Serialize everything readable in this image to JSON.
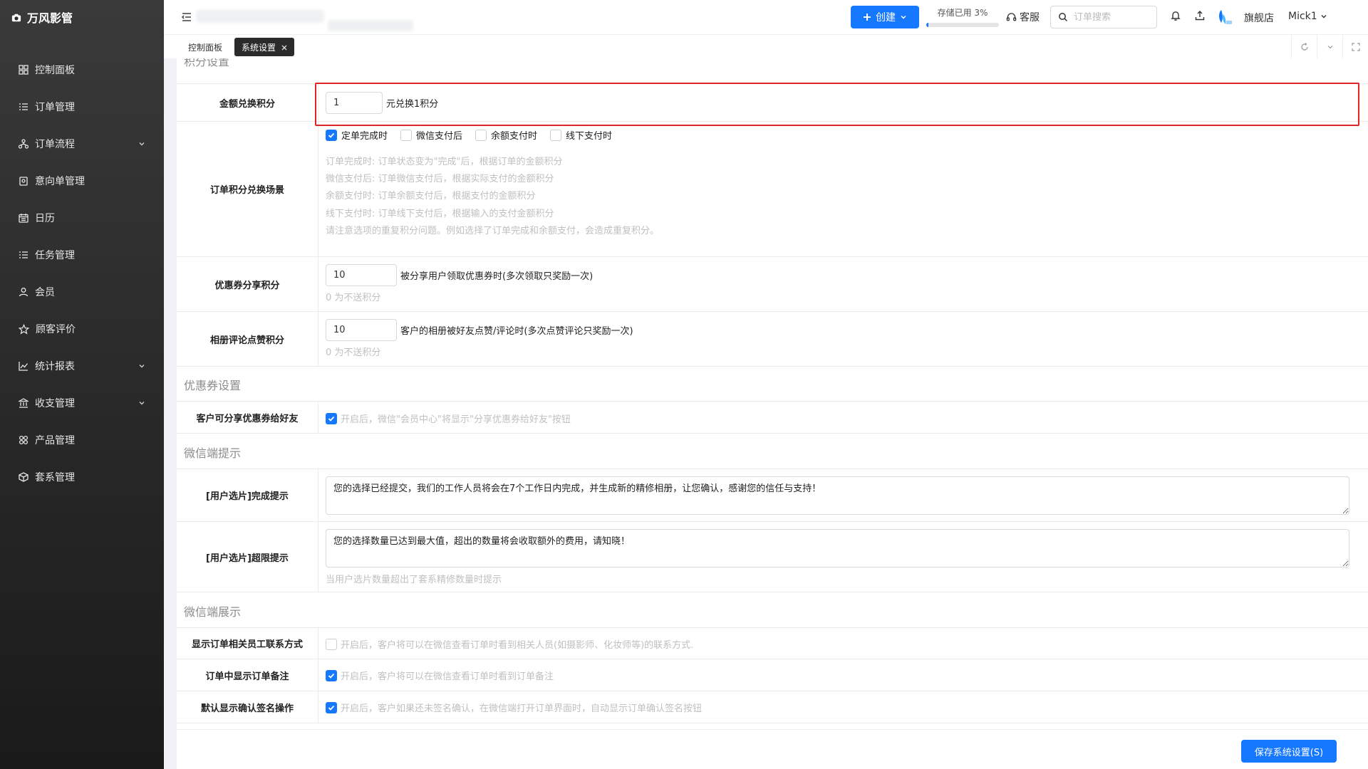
{
  "brand": {
    "name": "万风影管"
  },
  "sidebar": {
    "items": [
      {
        "label": "控制面板",
        "icon": "grid-icon",
        "expandable": false
      },
      {
        "label": "订单管理",
        "icon": "list-icon",
        "expandable": false
      },
      {
        "label": "订单流程",
        "icon": "flow-icon",
        "expandable": true
      },
      {
        "label": "意向单管理",
        "icon": "clipboard-icon",
        "expandable": false
      },
      {
        "label": "日历",
        "icon": "calendar-icon",
        "expandable": false
      },
      {
        "label": "任务管理",
        "icon": "tasks-icon",
        "expandable": false
      },
      {
        "label": "会员",
        "icon": "user-icon",
        "expandable": false
      },
      {
        "label": "顾客评价",
        "icon": "star-icon",
        "expandable": false
      },
      {
        "label": "统计报表",
        "icon": "chart-icon",
        "expandable": true
      },
      {
        "label": "收支管理",
        "icon": "bank-icon",
        "expandable": true
      },
      {
        "label": "产品管理",
        "icon": "products-icon",
        "expandable": false
      },
      {
        "label": "套系管理",
        "icon": "package-icon",
        "expandable": false
      }
    ]
  },
  "header": {
    "create_label": "创建",
    "storage_label": "存储已用 3%",
    "storage_percent": 3,
    "customer_service": "客服",
    "search_placeholder": "订单搜索",
    "shop_name": "旗舰店",
    "user_name": "Mick1"
  },
  "tabs": [
    {
      "label": "控制面板",
      "active": false
    },
    {
      "label": "系统设置",
      "active": true
    }
  ],
  "points": {
    "partial_title": "积分设置",
    "exchange": {
      "label": "金额兑换积分",
      "value": "1",
      "suffix": "元兑换1积分"
    },
    "scene": {
      "label": "订单积分兑换场景",
      "options": [
        {
          "label": "定单完成时",
          "checked": true
        },
        {
          "label": "微信支付后",
          "checked": false
        },
        {
          "label": "余额支付时",
          "checked": false
        },
        {
          "label": "线下支付时",
          "checked": false
        }
      ],
      "hints": [
        "订单完成时: 订单状态变为\"完成\"后，根据订单的金额积分",
        "微信支付后: 订单微信支付后，根据实际支付的金额积分",
        "余额支付时: 订单余额支付后，根据支付的金额积分",
        "线下支付时: 订单线下支付后，根据输入的支付金额积分",
        "请注意选项的重复积分问题。例如选择了订单完成和余额支付，会造成重复积分。"
      ]
    },
    "coupon_share": {
      "label": "优惠券分享积分",
      "value": "10",
      "suffix": "被分享用户领取优惠券时(多次领取只奖励一次)",
      "hint": "0 为不送积分"
    },
    "album_comment": {
      "label": "相册评论点赞积分",
      "value": "10",
      "suffix": "客户的相册被好友点赞/评论时(多次点赞评论只奖励一次)",
      "hint": "0 为不送积分"
    }
  },
  "coupon": {
    "title": "优惠券设置",
    "share_friends": {
      "label": "客户可分享优惠券给好友",
      "checked": true,
      "hint": "开启后，微信\"会员中心\"将显示\"分享优惠券给好友\"按钮"
    }
  },
  "wechat_tips": {
    "title": "微信端提示",
    "done": {
      "label": "[用户选片]完成提示",
      "value": "您的选择已经提交，我们的工作人员将会在7个工作日内完成，并生成新的精修相册，让您确认，感谢您的信任与支持！"
    },
    "limit": {
      "label": "[用户选片]超限提示",
      "value": "您的选择数量已达到最大值，超出的数量将会收取额外的费用，请知晓！",
      "hint": "当用户选片数量超出了套系精修数量时提示"
    }
  },
  "wechat_display": {
    "title": "微信端展示",
    "staff_contact": {
      "label": "显示订单相关员工联系方式",
      "checked": false,
      "hint": "开启后，客户将可以在微信查看订单时看到相关人员(如摄影师、化妆师等)的联系方式."
    },
    "order_note": {
      "label": "订单中显示订单备注",
      "checked": true,
      "hint": "开启后，客户将可以在微信查看订单时看到订单备注"
    },
    "sign_confirm": {
      "label": "默认显示确认签名操作",
      "checked": true,
      "hint": "开启后，客户如果还未签名确认，在微信端打开订单界面时，自动显示订单确认签名按钮"
    }
  },
  "footer": {
    "save_label": "保存系统设置(S)"
  },
  "colors": {
    "primary": "#1677ff",
    "highlight": "#e02424",
    "sidebar_top": "#3a3a3a",
    "sidebar_bottom": "#1a1a1a"
  }
}
